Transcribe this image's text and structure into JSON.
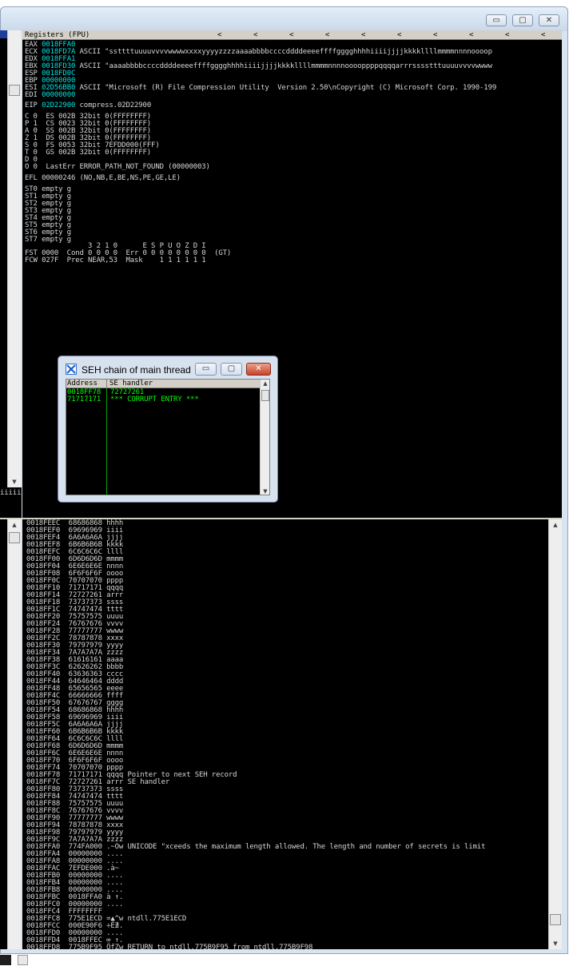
{
  "window": {
    "min_glyph": "▭",
    "max_glyph": "▢",
    "close_glyph": "✕"
  },
  "left_pane": {
    "fragment": "iiiii"
  },
  "registers": {
    "header_title": "Registers (FPU)",
    "nav_glyph": "<",
    "lines": [
      {
        "name": "EAX",
        "value": "0018FFA0",
        "comment": ""
      },
      {
        "name": "ECX",
        "value": "0018FD7A",
        "comment": "ASCII \"ssttttuuuuvvvvwwwwxxxxyyyyzzzzaaaabbbbccccddddeeeeffffgggghhhhiiiijjjjkkkkllllmmmmnnnnoooop"
      },
      {
        "name": "EDX",
        "value": "0018FFA1",
        "comment": ""
      },
      {
        "name": "EBX",
        "value": "0018FD30",
        "comment": "ASCII \"aaaabbbbccccddddeeeeffffgggghhhhiiiijjjjkkkkllllmmmmnnnnooooppppqqqqarrrsssstttuuuuvvvvwwww"
      },
      {
        "name": "ESP",
        "value": "0018FD0C",
        "comment": ""
      },
      {
        "name": "EBP",
        "value": "00000000",
        "comment": ""
      },
      {
        "name": "ESI",
        "value": "02D56BB0",
        "comment": "ASCII \"Microsoft (R) File Compression Utility  Version 2.50\\nCopyright (C) Microsoft Corp. 1990-199"
      },
      {
        "name": "EDI",
        "value": "00000000",
        "comment": ""
      }
    ],
    "eip": {
      "name": "EIP",
      "value": "02D22900",
      "comment": "compress.02D22900"
    },
    "flags": [
      "C 0  ES 002B 32bit 0(FFFFFFFF)",
      "P 1  CS 0023 32bit 0(FFFFFFFF)",
      "A 0  SS 002B 32bit 0(FFFFFFFF)",
      "Z 1  DS 002B 32bit 0(FFFFFFFF)",
      "S 0  FS 0053 32bit 7EFDD000(FFF)",
      "T 0  GS 002B 32bit 0(FFFFFFFF)",
      "D 0",
      "O 0  LastErr ERROR_PATH_NOT_FOUND (00000003)"
    ],
    "efl": "EFL 00000246 (NO,NB,E,BE,NS,PE,GE,LE)",
    "fpu": [
      "ST0 empty g",
      "ST1 empty g",
      "ST2 empty g",
      "ST3 empty g",
      "ST4 empty g",
      "ST5 empty g",
      "ST6 empty g",
      "ST7 empty g"
    ],
    "fst_header": "               3 2 1 0      E S P U O Z D I",
    "fst": "FST 0000  Cond 0 0 0 0  Err 0 0 0 0 0 0 0 0  (GT)",
    "fcw": "FCW 027F  Prec NEAR,53  Mask    1 1 1 1 1 1"
  },
  "seh_dialog": {
    "title": "SEH chain of main thread",
    "col_address": "Address",
    "col_handler": "SE handler",
    "rows": [
      {
        "address": "0018FF78",
        "handler": "72727261"
      },
      {
        "address": "71717171",
        "handler": "*** CORRUPT ENTRY ***"
      }
    ]
  },
  "stack": [
    "0018FEEC  68686868 hhhh",
    "0018FEF0  69696969 iiii",
    "0018FEF4  6A6A6A6A jjjj",
    "0018FEF8  6B6B6B6B kkkk",
    "0018FEFC  6C6C6C6C llll",
    "0018FF00  6D6D6D6D mmmm",
    "0018FF04  6E6E6E6E nnnn",
    "0018FF08  6F6F6F6F oooo",
    "0018FF0C  70707070 pppp",
    "0018FF10  71717171 qqqq",
    "0018FF14  72727261 arrr",
    "0018FF18  73737373 ssss",
    "0018FF1C  74747474 tttt",
    "0018FF20  75757575 uuuu",
    "0018FF24  76767676 vvvv",
    "0018FF28  77777777 wwww",
    "0018FF2C  78787878 xxxx",
    "0018FF30  79797979 yyyy",
    "0018FF34  7A7A7A7A zzzz",
    "0018FF38  61616161 aaaa",
    "0018FF3C  62626262 bbbb",
    "0018FF40  63636363 cccc",
    "0018FF44  64646464 dddd",
    "0018FF48  65656565 eeee",
    "0018FF4C  66666666 ffff",
    "0018FF50  67676767 gggg",
    "0018FF54  68686868 hhhh",
    "0018FF58  69696969 iiii",
    "0018FF5C  6A6A6A6A jjjj",
    "0018FF60  6B6B6B6B kkkk",
    "0018FF64  6C6C6C6C llll",
    "0018FF68  6D6D6D6D mmmm",
    "0018FF6C  6E6E6E6E nnnn",
    "0018FF70  6F6F6F6F oooo",
    "0018FF74  70707070 pppp",
    "0018FF78  71717171 qqqq Pointer to next SEH record",
    "0018FF7C  72727261 arrr SE handler",
    "0018FF80  73737373 ssss",
    "0018FF84  74747474 tttt",
    "0018FF88  75757575 uuuu",
    "0018FF8C  76767676 vvvv",
    "0018FF90  77777777 wwww",
    "0018FF94  78787878 xxxx",
    "0018FF98  79797979 yyyy",
    "0018FF9C  7A7A7A7A zzzz",
    "0018FFA0  774FA000 .~Ow UNICODE \"xceeds the maximum length allowed. The length and number of secrets is limit",
    "0018FFA4  00000000 ....",
    "0018FFA8  00000000 ....",
    "0018FFAC  7EFDE000 .à~",
    "0018FFB0  00000000 ....",
    "0018FFB4  00000000 ....",
    "0018FFB8  00000000 ....",
    "0018FFBC  0018FFA0 à ↑.",
    "0018FFC0  00000000 ....",
    "0018FFC4  FFFFFFFF",
    "0018FFC8  775E1ECD =▲^w ntdll.775E1ECD",
    "0018FFCC  000E90F6 ÷É∄.",
    "0018FFD0  00000000 ....",
    "0018FFD4  0018FFEC ∞ ↑.",
    "0018FFD8  775B9F95 ÖƒZw RETURN to ntdll.775B9F95 from ntdll.775B9F98"
  ]
}
